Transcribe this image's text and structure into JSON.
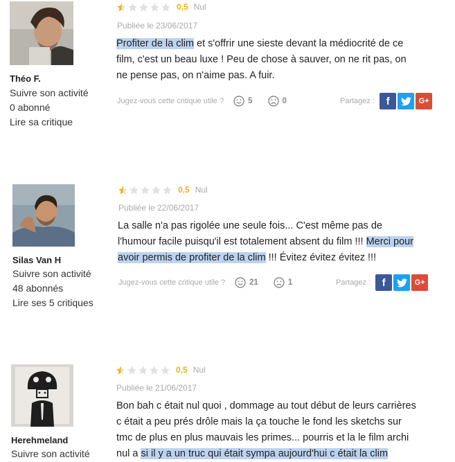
{
  "reviews": [
    {
      "user": {
        "name": "Théo F.",
        "follow": "Suivre son activité",
        "followers": "0 abonné",
        "reviews_link": "Lire sa critique"
      },
      "rating": {
        "stars_filled": 0.5,
        "stars_total": 5,
        "score": "0,5",
        "word": "Nul"
      },
      "date": "Publiée le 23/06/2017",
      "text": {
        "hl_start": "Profiter de la clim",
        "line1_rest": " et s'offrir une sieste devant la médiocrité de ce",
        "line2": "film, c'est un beau luxe ! Peu de chose à sauver, on ne rit pas, on",
        "line3": "ne pense pas, on n'aime pas. A fuir."
      },
      "useful_label": "Jugez-vous cette critique utile ?",
      "votes_up": "5",
      "votes_down": "0",
      "share_label": "Partagez :"
    },
    {
      "user": {
        "name": "Silas Van H",
        "follow": "Suivre son activité",
        "followers": "48 abonnés",
        "reviews_link": "Lire ses 5 critiques"
      },
      "rating": {
        "stars_filled": 0.5,
        "stars_total": 5,
        "score": "0,5",
        "word": "Nul"
      },
      "date": "Publiée le 22/06/2017",
      "text": {
        "line1": "La salle n'a pas rigolée une seule fois... C'est même pas de",
        "line2_start": "l'humour facile puisqu'il est totalement absent du film !!! ",
        "line2_hl": "Merci pour",
        "line3_hl": "avoir permis de profiter de la clim",
        "line3_rest": " !!! Évitez évitez évitez !!!"
      },
      "useful_label": "Jugez-vous cette critique utile ?",
      "votes_up": "21",
      "votes_down": "1",
      "share_label": "Partagez :"
    },
    {
      "user": {
        "name": "Herehmeland",
        "follow": "Suivre son activité"
      },
      "rating": {
        "stars_filled": 0.5,
        "stars_total": 5,
        "score": "0,5",
        "word": "Nul"
      },
      "date": "Publiée le 21/06/2017",
      "text": {
        "line1": "Bon bah c était nul quoi , dommage au tout début de leurs carrières",
        "line2": "c était a peu prés drôle mais la ça touche le fond les sketchs sur",
        "line3": "tmc de plus en plus mauvais les primes... pourris et la le film archi",
        "line4_start": "nul a ",
        "line4_hl": "si il y a un truc qui était sympa aujourd'hui c était la clim"
      }
    }
  ],
  "share_buttons": {
    "facebook": "f",
    "twitter": "twitter-bird-icon",
    "google": "G+"
  },
  "colors": {
    "star_gold": "#f1b400",
    "star_grey": "#e0e0e0",
    "highlight": "#bcd3f0",
    "facebook": "#3b5998",
    "twitter": "#1da1f2",
    "google": "#dd4b39"
  }
}
